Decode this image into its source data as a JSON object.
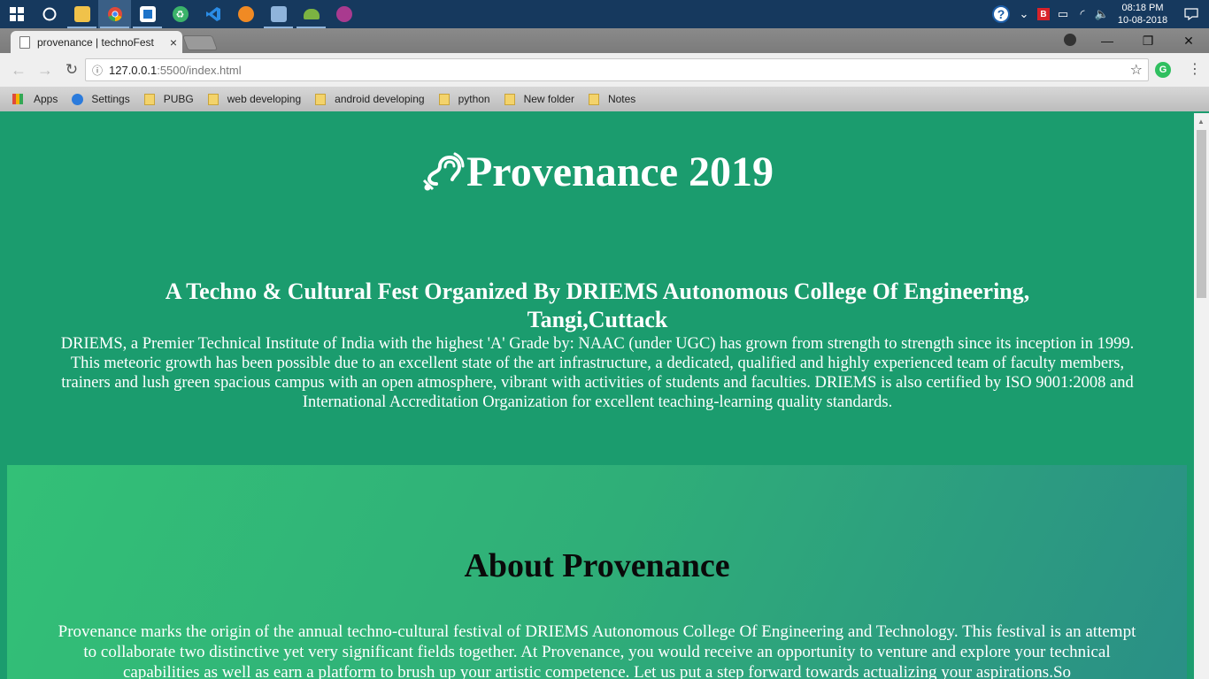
{
  "taskbar": {
    "apps": [
      {
        "name": "windows-start",
        "icon": "windows-logo-icon"
      },
      {
        "name": "cortana",
        "icon": "cortana-circle-icon"
      },
      {
        "name": "file-explorer",
        "icon": "folder-icon"
      },
      {
        "name": "chrome",
        "icon": "chrome-icon"
      },
      {
        "name": "app-blue",
        "icon": "app-window-icon"
      },
      {
        "name": "app-green",
        "icon": "recycle-icon"
      },
      {
        "name": "vscode",
        "icon": "vscode-icon"
      },
      {
        "name": "app-orange",
        "icon": "bird-icon"
      },
      {
        "name": "app-photos",
        "icon": "photos-icon"
      },
      {
        "name": "android-studio",
        "icon": "android-icon"
      },
      {
        "name": "app-purple",
        "icon": "purple-app-icon"
      }
    ],
    "time": "08:18 PM",
    "date": "10-08-2018"
  },
  "browser": {
    "tab_title": "provenance | technoFest",
    "url_host": "127.0.0.1",
    "url_path": ":5500/index.html",
    "bookmarks": [
      "Apps",
      "Settings",
      "PUBG",
      "web developing",
      "android developing",
      "python",
      "New folder",
      "Notes"
    ]
  },
  "page": {
    "title": "Provenance 2019",
    "subtitle": "A Techno & Cultural Fest Organized By DRIEMS Autonomous College Of Engineering, Tangi,Cuttack",
    "intro": "DRIEMS, a Premier Technical Institute of India with the highest 'A' Grade by: NAAC (under UGC) has grown from strength to strength since its inception in 1999. This meteoric growth has been possible due to an excellent state of the art infrastructure, a dedicated, qualified and highly experienced team of faculty members, trainers and lush green spacious campus with an open atmosphere, vibrant with activities of students and faculties. DRIEMS is also certified by ISO 9001:2008 and International Accreditation Organization for excellent teaching-learning quality standards.",
    "about_heading": "About Provenance",
    "about_text": "Provenance marks the origin of the annual techno-cultural festival of DRIEMS Autonomous College Of Engineering and Technology. This festival is an attempt to collaborate two distinctive yet very significant fields together. At Provenance, you would receive an opportunity to venture and explore your technical capabilities as well as earn a platform to brush up your artistic competence. Let us put a step forward towards actualizing your aspirations.So"
  },
  "colors": {
    "page_bg": "#1b9c6e",
    "about_gradient_start": "#33c077",
    "about_gradient_end": "#2a8f86",
    "taskbar_bg": "#16395e"
  }
}
